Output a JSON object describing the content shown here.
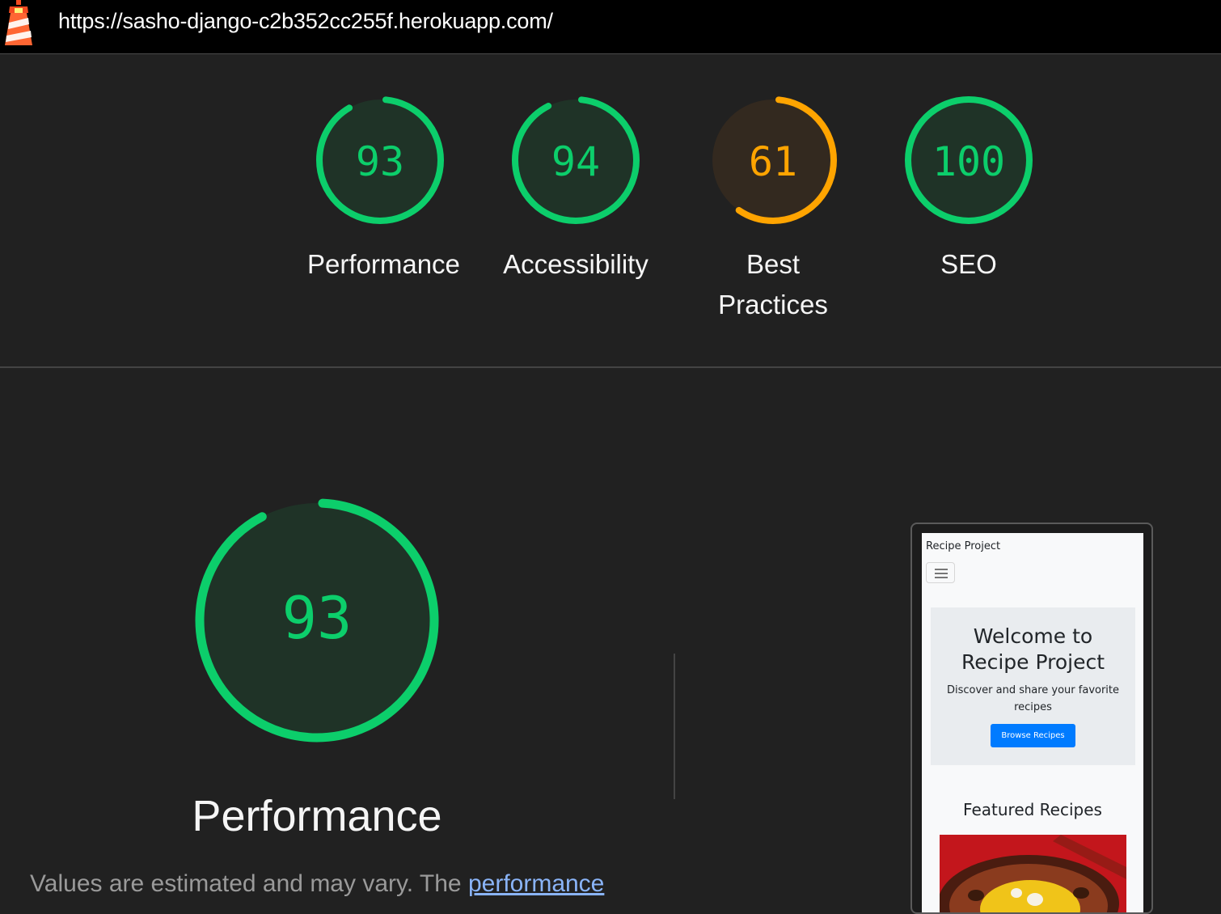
{
  "url": "https://sasho-django-c2b352cc255f.herokuapp.com/",
  "colors": {
    "pass": "#0cce6b",
    "average": "#ffa400"
  },
  "scores": [
    {
      "value": 93,
      "label": "Performance"
    },
    {
      "value": 94,
      "label": "Accessibility"
    },
    {
      "value": 61,
      "label_line1": "Best",
      "label_line2": "Practices"
    },
    {
      "value": 100,
      "label": "SEO"
    }
  ],
  "main": {
    "score": 93,
    "title": "Performance",
    "note_prefix": "Values are estimated and may vary. The",
    "note_link": "performance"
  },
  "preview": {
    "brand": "Recipe Project",
    "hero_title_line1": "Welcome to",
    "hero_title_line2": "Recipe Project",
    "hero_text_line1": "Discover and share your favorite",
    "hero_text_line2": "recipes",
    "button": "Browse Recipes",
    "section_title": "Featured Recipes"
  }
}
